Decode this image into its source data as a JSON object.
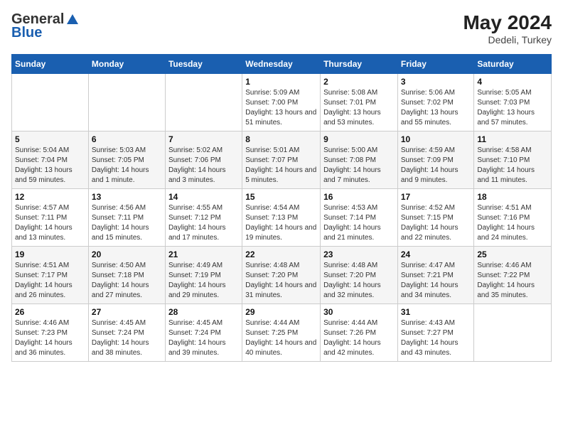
{
  "header": {
    "logo_general": "General",
    "logo_blue": "Blue",
    "month_title": "May 2024",
    "subtitle": "Dedeli, Turkey"
  },
  "weekdays": [
    "Sunday",
    "Monday",
    "Tuesday",
    "Wednesday",
    "Thursday",
    "Friday",
    "Saturday"
  ],
  "weeks": [
    [
      null,
      null,
      null,
      {
        "day": "1",
        "sunrise": "5:09 AM",
        "sunset": "7:00 PM",
        "daylight": "13 hours and 51 minutes."
      },
      {
        "day": "2",
        "sunrise": "5:08 AM",
        "sunset": "7:01 PM",
        "daylight": "13 hours and 53 minutes."
      },
      {
        "day": "3",
        "sunrise": "5:06 AM",
        "sunset": "7:02 PM",
        "daylight": "13 hours and 55 minutes."
      },
      {
        "day": "4",
        "sunrise": "5:05 AM",
        "sunset": "7:03 PM",
        "daylight": "13 hours and 57 minutes."
      }
    ],
    [
      {
        "day": "5",
        "sunrise": "5:04 AM",
        "sunset": "7:04 PM",
        "daylight": "13 hours and 59 minutes."
      },
      {
        "day": "6",
        "sunrise": "5:03 AM",
        "sunset": "7:05 PM",
        "daylight": "14 hours and 1 minute."
      },
      {
        "day": "7",
        "sunrise": "5:02 AM",
        "sunset": "7:06 PM",
        "daylight": "14 hours and 3 minutes."
      },
      {
        "day": "8",
        "sunrise": "5:01 AM",
        "sunset": "7:07 PM",
        "daylight": "14 hours and 5 minutes."
      },
      {
        "day": "9",
        "sunrise": "5:00 AM",
        "sunset": "7:08 PM",
        "daylight": "14 hours and 7 minutes."
      },
      {
        "day": "10",
        "sunrise": "4:59 AM",
        "sunset": "7:09 PM",
        "daylight": "14 hours and 9 minutes."
      },
      {
        "day": "11",
        "sunrise": "4:58 AM",
        "sunset": "7:10 PM",
        "daylight": "14 hours and 11 minutes."
      }
    ],
    [
      {
        "day": "12",
        "sunrise": "4:57 AM",
        "sunset": "7:11 PM",
        "daylight": "14 hours and 13 minutes."
      },
      {
        "day": "13",
        "sunrise": "4:56 AM",
        "sunset": "7:11 PM",
        "daylight": "14 hours and 15 minutes."
      },
      {
        "day": "14",
        "sunrise": "4:55 AM",
        "sunset": "7:12 PM",
        "daylight": "14 hours and 17 minutes."
      },
      {
        "day": "15",
        "sunrise": "4:54 AM",
        "sunset": "7:13 PM",
        "daylight": "14 hours and 19 minutes."
      },
      {
        "day": "16",
        "sunrise": "4:53 AM",
        "sunset": "7:14 PM",
        "daylight": "14 hours and 21 minutes."
      },
      {
        "day": "17",
        "sunrise": "4:52 AM",
        "sunset": "7:15 PM",
        "daylight": "14 hours and 22 minutes."
      },
      {
        "day": "18",
        "sunrise": "4:51 AM",
        "sunset": "7:16 PM",
        "daylight": "14 hours and 24 minutes."
      }
    ],
    [
      {
        "day": "19",
        "sunrise": "4:51 AM",
        "sunset": "7:17 PM",
        "daylight": "14 hours and 26 minutes."
      },
      {
        "day": "20",
        "sunrise": "4:50 AM",
        "sunset": "7:18 PM",
        "daylight": "14 hours and 27 minutes."
      },
      {
        "day": "21",
        "sunrise": "4:49 AM",
        "sunset": "7:19 PM",
        "daylight": "14 hours and 29 minutes."
      },
      {
        "day": "22",
        "sunrise": "4:48 AM",
        "sunset": "7:20 PM",
        "daylight": "14 hours and 31 minutes."
      },
      {
        "day": "23",
        "sunrise": "4:48 AM",
        "sunset": "7:20 PM",
        "daylight": "14 hours and 32 minutes."
      },
      {
        "day": "24",
        "sunrise": "4:47 AM",
        "sunset": "7:21 PM",
        "daylight": "14 hours and 34 minutes."
      },
      {
        "day": "25",
        "sunrise": "4:46 AM",
        "sunset": "7:22 PM",
        "daylight": "14 hours and 35 minutes."
      }
    ],
    [
      {
        "day": "26",
        "sunrise": "4:46 AM",
        "sunset": "7:23 PM",
        "daylight": "14 hours and 36 minutes."
      },
      {
        "day": "27",
        "sunrise": "4:45 AM",
        "sunset": "7:24 PM",
        "daylight": "14 hours and 38 minutes."
      },
      {
        "day": "28",
        "sunrise": "4:45 AM",
        "sunset": "7:24 PM",
        "daylight": "14 hours and 39 minutes."
      },
      {
        "day": "29",
        "sunrise": "4:44 AM",
        "sunset": "7:25 PM",
        "daylight": "14 hours and 40 minutes."
      },
      {
        "day": "30",
        "sunrise": "4:44 AM",
        "sunset": "7:26 PM",
        "daylight": "14 hours and 42 minutes."
      },
      {
        "day": "31",
        "sunrise": "4:43 AM",
        "sunset": "7:27 PM",
        "daylight": "14 hours and 43 minutes."
      },
      null
    ]
  ]
}
